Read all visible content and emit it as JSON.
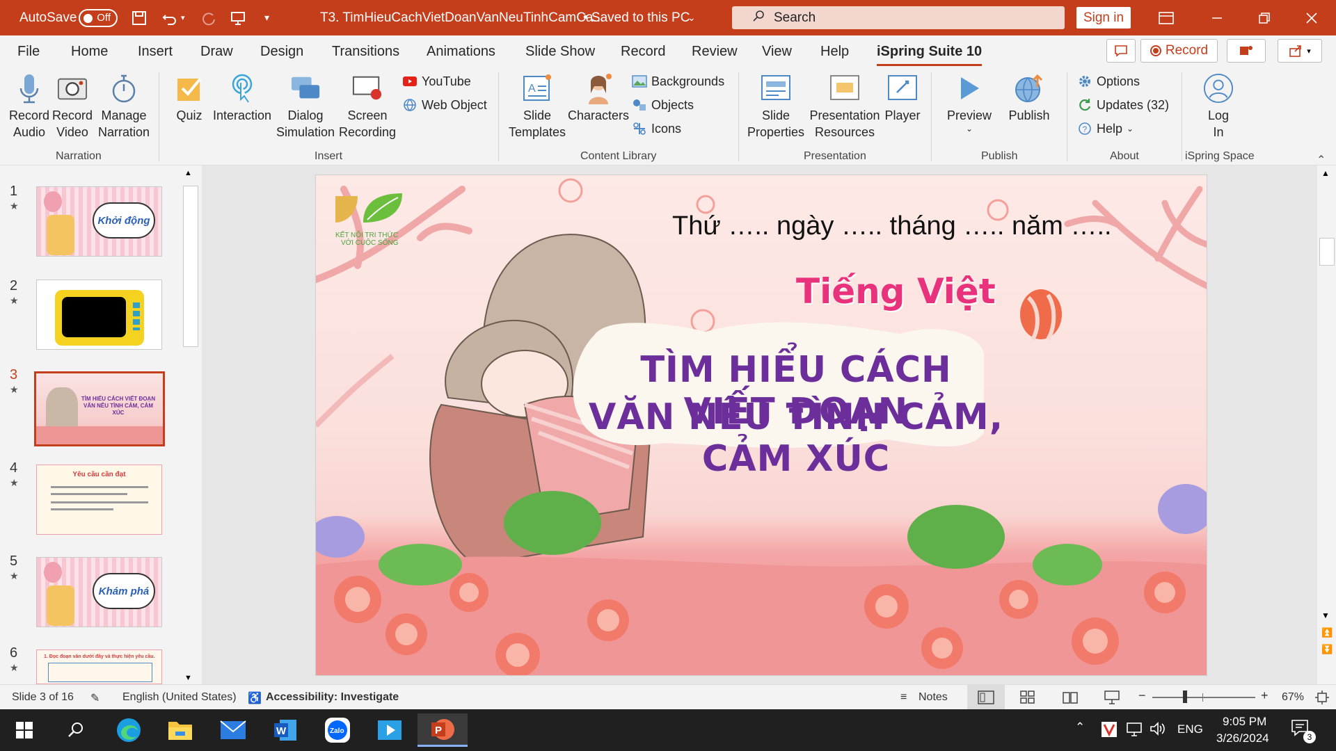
{
  "titlebar": {
    "autosave_label": "AutoSave",
    "autosave_state": "Off",
    "doc_title": "T3. TimHieuCachVietDoanVanNeuTinhCamCa...",
    "saved_status": "• Saved to this PC",
    "search_placeholder": "Search",
    "sign_in": "Sign in"
  },
  "menu": {
    "tabs": [
      "File",
      "Home",
      "Insert",
      "Draw",
      "Design",
      "Transitions",
      "Animations",
      "Slide Show",
      "Record",
      "Review",
      "View",
      "Help",
      "iSpring Suite 10"
    ],
    "record_button": "Record"
  },
  "ribbon": {
    "narration": {
      "group": "Narration",
      "record_audio": [
        "Record",
        "Audio"
      ],
      "record_video": [
        "Record",
        "Video"
      ],
      "manage_narration": [
        "Manage",
        "Narration"
      ]
    },
    "insert": {
      "group": "Insert",
      "quiz": "Quiz",
      "interaction": "Interaction",
      "dialog": [
        "Dialog",
        "Simulation"
      ],
      "screen": [
        "Screen",
        "Recording"
      ],
      "youtube": "YouTube",
      "web_object": "Web Object"
    },
    "content_library": {
      "group": "Content Library",
      "slide_templates": [
        "Slide",
        "Templates"
      ],
      "characters": "Characters",
      "backgrounds": "Backgrounds",
      "objects": "Objects",
      "icons": "Icons"
    },
    "presentation": {
      "group": "Presentation",
      "slide_properties": [
        "Slide",
        "Properties"
      ],
      "presentation_resources": [
        "Presentation",
        "Resources"
      ],
      "player": "Player"
    },
    "publish": {
      "group": "Publish",
      "preview": "Preview",
      "publish": "Publish"
    },
    "about": {
      "group": "About",
      "options": "Options",
      "updates": "Updates (32)",
      "help": "Help"
    },
    "space": {
      "group": "iSpring Space",
      "login": [
        "Log",
        "In"
      ]
    }
  },
  "thumbnails": [
    {
      "num": "1",
      "text": "Khởi động"
    },
    {
      "num": "2",
      "text": ""
    },
    {
      "num": "3",
      "text": "TÌM HIỂU CÁCH VIẾT ĐOẠN VĂN NÊU TÌNH CẢM, CẢM XÚC"
    },
    {
      "num": "4",
      "text": "Yêu cầu cần đạt"
    },
    {
      "num": "5",
      "text": "Khám phá"
    },
    {
      "num": "6",
      "text": "1. Đọc đoạn văn dưới đây và thực hiện yêu cầu."
    }
  ],
  "slide": {
    "logo_text": [
      "KẾT NỐI TRI THỨC",
      "VỚI CUỘC SỐNG"
    ],
    "date_line": "Thứ ….. ngày ….. tháng ….. năm …..",
    "subject": "Tiếng Việt",
    "title_line1": "TÌM HIỂU CÁCH VIẾT ĐOẠN",
    "title_line2": "VĂN NÊU TÌNH CẢM, CẢM XÚC"
  },
  "status": {
    "slide_info": "Slide 3 of 16",
    "language": "English (United States)",
    "accessibility": "Accessibility: Investigate",
    "notes": "Notes",
    "zoom": "67%"
  },
  "taskbar": {
    "lang": "ENG",
    "time": "9:05 PM",
    "date": "3/26/2024",
    "notif_count": "3"
  },
  "colors": {
    "accent": "#c43e1c",
    "title_purple": "#6b2e9a",
    "subject_pink": "#e8327c"
  }
}
